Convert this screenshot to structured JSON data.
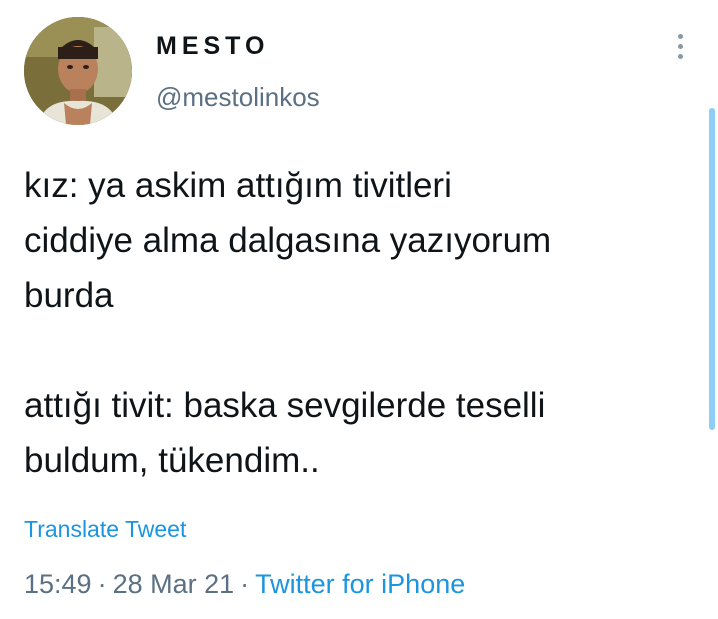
{
  "author": {
    "display_name": "MESTO",
    "handle": "@mestolinkos"
  },
  "tweet": {
    "lines_part1": [
      "kız: ya askim attığım tivitleri",
      "ciddiye alma dalgasına yazıyorum",
      "burda"
    ],
    "lines_part2": [
      "attığı tivit: baska sevgilerde teselli",
      "buldum, tükendim.."
    ]
  },
  "translate_label": "Translate Tweet",
  "meta": {
    "time": "15:49",
    "separator": "·",
    "date": "28 Mar 21",
    "source": "Twitter for iPhone"
  },
  "icons": {
    "more": "more-vertical-icon"
  },
  "colors": {
    "text": "#0f1419",
    "secondary": "#5b7083",
    "link": "#1b95e0",
    "scrollbar": "#8ecdf7"
  }
}
